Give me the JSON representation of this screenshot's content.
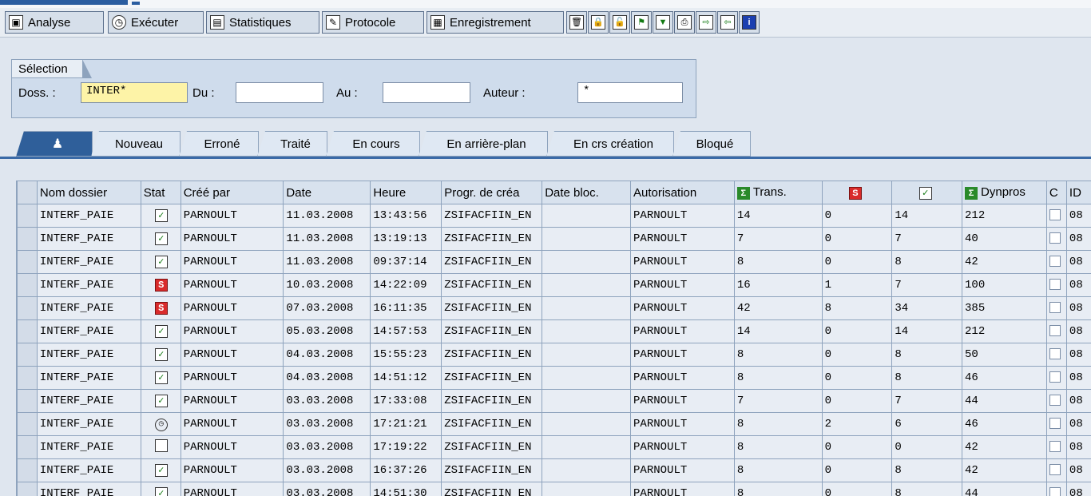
{
  "toolbar": {
    "buttons": [
      {
        "label": "Analyse",
        "icon": "analyse-icon"
      },
      {
        "label": "Exécuter",
        "icon": "execute-clock-icon"
      },
      {
        "label": "Statistiques",
        "icon": "statistics-icon"
      },
      {
        "label": "Protocole",
        "icon": "protocol-icon"
      },
      {
        "label": "Enregistrement",
        "icon": "record-icon"
      }
    ],
    "icon_buttons": [
      "delete-icon",
      "lock-icon",
      "unlock-icon",
      "flag-icon",
      "filter-icon",
      "print-icon",
      "export-icon",
      "import-icon",
      "info-icon"
    ]
  },
  "selection": {
    "title": "Sélection",
    "doss_label": "Doss. :",
    "doss_value": "INTER*",
    "du_label": "Du :",
    "du_value": "",
    "au_label": "Au :",
    "au_value": "",
    "auteur_label": "Auteur :",
    "auteur_value": "*"
  },
  "tabs": [
    "Nouveau",
    "Erroné",
    "Traité",
    "En cours",
    "En arrière-plan",
    "En crs création",
    "Bloqué"
  ],
  "table": {
    "columns": [
      "Nom dossier",
      "Stat",
      "Créé par",
      "Date",
      "Heure",
      "Progr. de créa",
      "Date bloc.",
      "Autorisation",
      "Trans.",
      "",
      "",
      "Dynpros",
      "C",
      "ID"
    ],
    "rows": [
      {
        "name": "INTERF_PAIE",
        "stat": "ok",
        "by": "PARNOULT",
        "date": "11.03.2008",
        "time": "13:43:56",
        "prog": "ZSIFACFIIN_EN",
        "bloc": "",
        "auth": "PARNOULT",
        "trans": "14",
        "err": "0",
        "ok": "14",
        "dyn": "212",
        "id": "08"
      },
      {
        "name": "INTERF_PAIE",
        "stat": "ok",
        "by": "PARNOULT",
        "date": "11.03.2008",
        "time": "13:19:13",
        "prog": "ZSIFACFIIN_EN",
        "bloc": "",
        "auth": "PARNOULT",
        "trans": "7",
        "err": "0",
        "ok": "7",
        "dyn": "40",
        "id": "08"
      },
      {
        "name": "INTERF_PAIE",
        "stat": "ok",
        "by": "PARNOULT",
        "date": "11.03.2008",
        "time": "09:37:14",
        "prog": "ZSIFACFIIN_EN",
        "bloc": "",
        "auth": "PARNOULT",
        "trans": "8",
        "err": "0",
        "ok": "8",
        "dyn": "42",
        "id": "08"
      },
      {
        "name": "INTERF_PAIE",
        "stat": "err",
        "by": "PARNOULT",
        "date": "10.03.2008",
        "time": "14:22:09",
        "prog": "ZSIFACFIIN_EN",
        "bloc": "",
        "auth": "PARNOULT",
        "trans": "16",
        "err": "1",
        "ok": "7",
        "dyn": "100",
        "id": "08"
      },
      {
        "name": "INTERF_PAIE",
        "stat": "err",
        "by": "PARNOULT",
        "date": "07.03.2008",
        "time": "16:11:35",
        "prog": "ZSIFACFIIN_EN",
        "bloc": "",
        "auth": "PARNOULT",
        "trans": "42",
        "err": "8",
        "ok": "34",
        "dyn": "385",
        "id": "08"
      },
      {
        "name": "INTERF_PAIE",
        "stat": "ok",
        "by": "PARNOULT",
        "date": "05.03.2008",
        "time": "14:57:53",
        "prog": "ZSIFACFIIN_EN",
        "bloc": "",
        "auth": "PARNOULT",
        "trans": "14",
        "err": "0",
        "ok": "14",
        "dyn": "212",
        "id": "08"
      },
      {
        "name": "INTERF_PAIE",
        "stat": "ok",
        "by": "PARNOULT",
        "date": "04.03.2008",
        "time": "15:55:23",
        "prog": "ZSIFACFIIN_EN",
        "bloc": "",
        "auth": "PARNOULT",
        "trans": "8",
        "err": "0",
        "ok": "8",
        "dyn": "50",
        "id": "08"
      },
      {
        "name": "INTERF_PAIE",
        "stat": "ok",
        "by": "PARNOULT",
        "date": "04.03.2008",
        "time": "14:51:12",
        "prog": "ZSIFACFIIN_EN",
        "bloc": "",
        "auth": "PARNOULT",
        "trans": "8",
        "err": "0",
        "ok": "8",
        "dyn": "46",
        "id": "08"
      },
      {
        "name": "INTERF_PAIE",
        "stat": "ok",
        "by": "PARNOULT",
        "date": "03.03.2008",
        "time": "17:33:08",
        "prog": "ZSIFACFIIN_EN",
        "bloc": "",
        "auth": "PARNOULT",
        "trans": "7",
        "err": "0",
        "ok": "7",
        "dyn": "44",
        "id": "08"
      },
      {
        "name": "INTERF_PAIE",
        "stat": "clock",
        "by": "PARNOULT",
        "date": "03.03.2008",
        "time": "17:21:21",
        "prog": "ZSIFACFIIN_EN",
        "bloc": "",
        "auth": "PARNOULT",
        "trans": "8",
        "err": "2",
        "ok": "6",
        "dyn": "46",
        "id": "08"
      },
      {
        "name": "INTERF_PAIE",
        "stat": "doc",
        "by": "PARNOULT",
        "date": "03.03.2008",
        "time": "17:19:22",
        "prog": "ZSIFACFIIN_EN",
        "bloc": "",
        "auth": "PARNOULT",
        "trans": "8",
        "err": "0",
        "ok": "0",
        "dyn": "42",
        "id": "08"
      },
      {
        "name": "INTERF_PAIE",
        "stat": "ok",
        "by": "PARNOULT",
        "date": "03.03.2008",
        "time": "16:37:26",
        "prog": "ZSIFACFIIN_EN",
        "bloc": "",
        "auth": "PARNOULT",
        "trans": "8",
        "err": "0",
        "ok": "8",
        "dyn": "42",
        "id": "08"
      },
      {
        "name": "INTERF_PAIE",
        "stat": "ok",
        "by": "PARNOULT",
        "date": "03.03.2008",
        "time": "14:51:30",
        "prog": "ZSIFACFIIN_EN",
        "bloc": "",
        "auth": "PARNOULT",
        "trans": "8",
        "err": "0",
        "ok": "8",
        "dyn": "44",
        "id": "08"
      }
    ]
  },
  "colors": {
    "accent": "#2f5f9a",
    "error": "#d92b2b",
    "ok": "#137a13",
    "highlight": "#fdf3a7"
  }
}
